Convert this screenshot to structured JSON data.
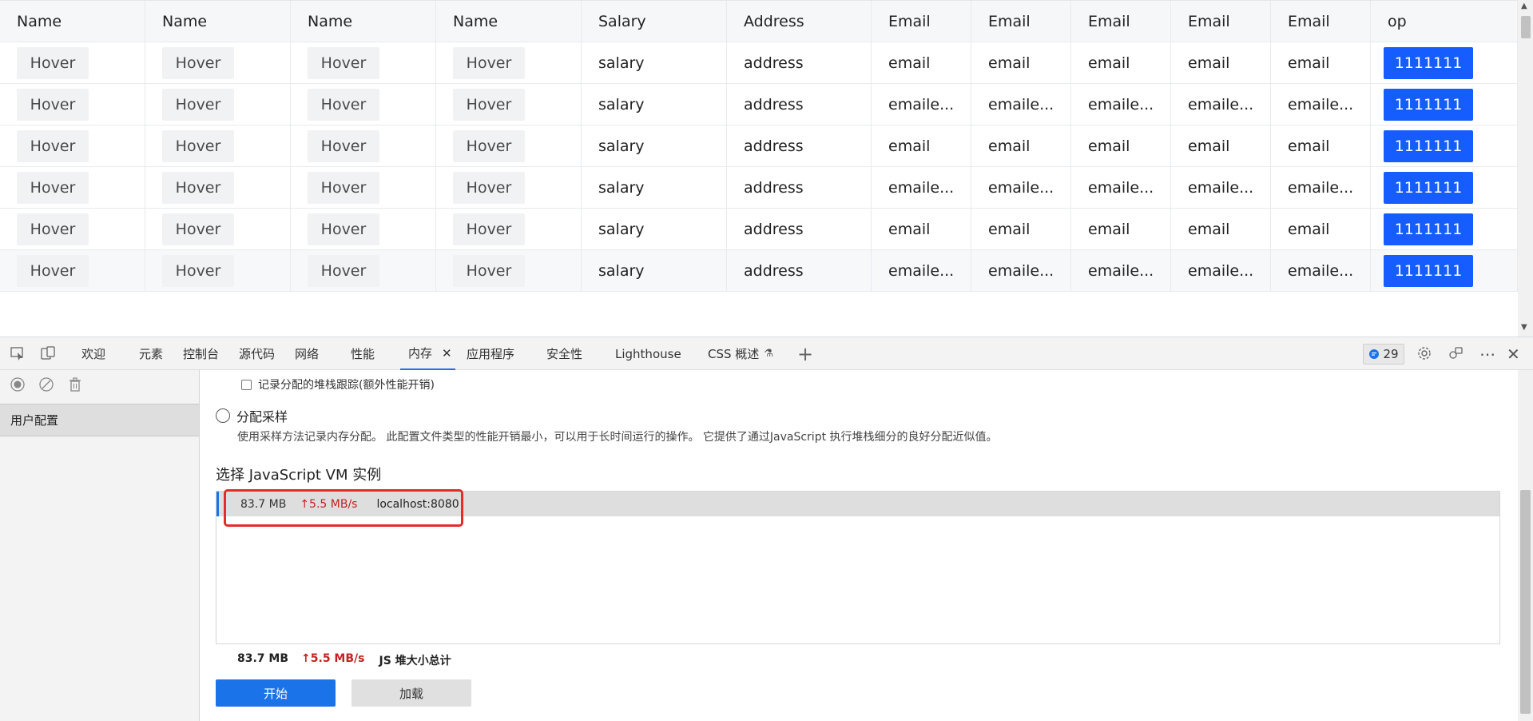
{
  "table": {
    "headers": [
      "Name",
      "Name",
      "Name",
      "Name",
      "Salary",
      "Address",
      "Email",
      "Email",
      "Email",
      "Email",
      "Email",
      "op"
    ],
    "rows": [
      {
        "hover": "Hover",
        "salary": "salary",
        "address": "address",
        "email": "email",
        "op": "1111111"
      },
      {
        "hover": "Hover",
        "salary": "salary",
        "address": "address",
        "email": "emaile...",
        "op": "1111111"
      },
      {
        "hover": "Hover",
        "salary": "salary",
        "address": "address",
        "email": "email",
        "op": "1111111"
      },
      {
        "hover": "Hover",
        "salary": "salary",
        "address": "address",
        "email": "emaile...",
        "op": "1111111"
      },
      {
        "hover": "Hover",
        "salary": "salary",
        "address": "address",
        "email": "email",
        "op": "1111111"
      },
      {
        "hover": "Hover",
        "salary": "salary",
        "address": "address",
        "email": "emaile...",
        "op": "1111111"
      }
    ]
  },
  "devtools": {
    "tabs": [
      "欢迎",
      "元素",
      "控制台",
      "源代码",
      "网络",
      "性能",
      "内存",
      "应用程序",
      "安全性",
      "Lighthouse",
      "CSS 概述"
    ],
    "active_tab": "内存",
    "issues_count": "29"
  },
  "left_panel": {
    "profile_item": "用户配置"
  },
  "memory": {
    "stack_trace_label": "记录分配的堆栈跟踪(额外性能开销)",
    "sampling_label": "分配采样",
    "sampling_desc": "使用采样方法记录内存分配。 此配置文件类型的性能开销最小，可以用于长时间运行的操作。 它提供了通过JavaScript 执行堆栈细分的良好分配近似值。",
    "vm_title": "选择 JavaScript VM 实例",
    "vm_instance": {
      "mem": "83.7 MB",
      "rate": "↑5.5 MB/s",
      "host": "localhost:8080"
    },
    "summary": {
      "mem": "83.7 MB",
      "rate": "↑5.5 MB/s",
      "label": "JS 堆大小总计"
    },
    "start_label": "开始",
    "load_label": "加载"
  },
  "colors": {
    "accent": "#1a73e8",
    "op_button": "#165dff",
    "rate_red": "#c5221f",
    "highlight": "#e52b2b"
  }
}
